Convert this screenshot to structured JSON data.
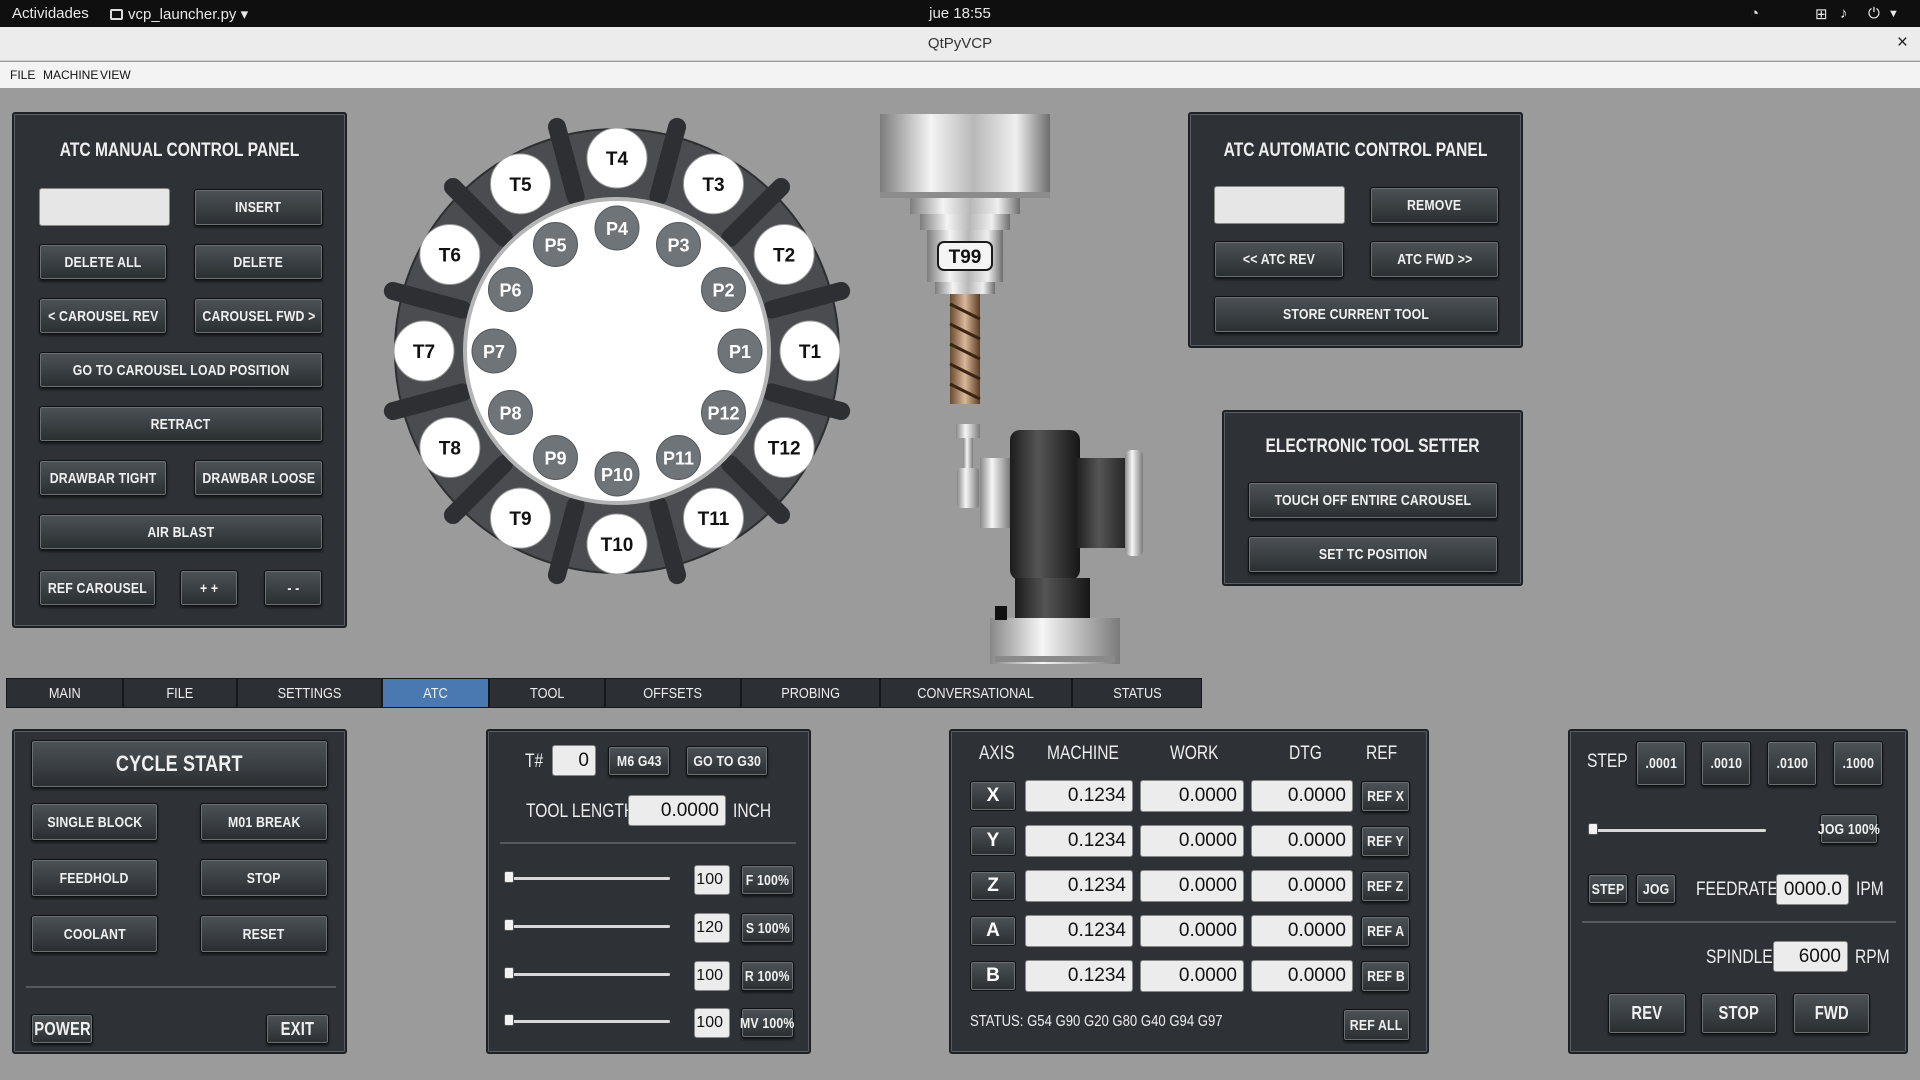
{
  "topbar": {
    "activities": "Actividades",
    "app_name": "vcp_launcher.py",
    "clock": "jue 18:55"
  },
  "window": {
    "title": "QtPyVCP",
    "close": "×"
  },
  "menu": [
    "FILE",
    "MACHINE",
    "VIEW"
  ],
  "atc_manual": {
    "title": "ATC MANUAL CONTROL PANEL",
    "tool_input": "",
    "insert": "INSERT",
    "delete_all": "DELETE ALL",
    "delete": "DELETE",
    "carousel_rev": "< CAROUSEL REV",
    "carousel_fwd": "CAROUSEL FWD >",
    "go_load": "GO TO CAROUSEL LOAD POSITION",
    "retract": "RETRACT",
    "drawbar_tight": "DRAWBAR TIGHT",
    "drawbar_loose": "DRAWBAR LOOSE",
    "air_blast": "AIR BLAST",
    "ref_carousel": "REF CAROUSEL",
    "plus": "+ +",
    "minus": "- -"
  },
  "carousel": {
    "tools": [
      "T1",
      "T2",
      "T3",
      "T4",
      "T5",
      "T6",
      "T7",
      "T8",
      "T9",
      "T10",
      "T11",
      "T12"
    ],
    "pockets": [
      "P1",
      "P2",
      "P3",
      "P4",
      "P5",
      "P6",
      "P7",
      "P8",
      "P9",
      "P10",
      "P11",
      "P12"
    ],
    "spindle_tool": "T99"
  },
  "atc_auto": {
    "title": "ATC AUTOMATIC CONTROL PANEL",
    "tool_input": "",
    "remove": "REMOVE",
    "atc_rev": "<< ATC REV",
    "atc_fwd": "ATC FWD >>",
    "store": "STORE CURRENT TOOL"
  },
  "tool_setter": {
    "title": "ELECTRONIC TOOL SETTER",
    "touch_off": "TOUCH OFF ENTIRE CAROUSEL",
    "set_tc": "SET TC POSITION"
  },
  "tabs": [
    {
      "label": "MAIN",
      "active": false
    },
    {
      "label": "FILE",
      "active": false
    },
    {
      "label": "SETTINGS",
      "active": false
    },
    {
      "label": "ATC",
      "active": true
    },
    {
      "label": "TOOL",
      "active": false
    },
    {
      "label": "OFFSETS",
      "active": false
    },
    {
      "label": "PROBING",
      "active": false
    },
    {
      "label": "CONVERSATIONAL",
      "active": false
    },
    {
      "label": "STATUS",
      "active": false
    }
  ],
  "cycle": {
    "cycle_start": "CYCLE START",
    "single_block": "SINGLE BLOCK",
    "m01_break": "M01 BREAK",
    "feedhold": "FEEDHOLD",
    "stop": "STOP",
    "coolant": "COOLANT",
    "reset": "RESET",
    "power": "POWER",
    "exit": "EXIT"
  },
  "tool_panel": {
    "t_label": "T#",
    "t_value": "0",
    "m6g43": "M6 G43",
    "gotog30": "GO TO G30",
    "tool_length_label": "TOOL LENGTH",
    "tool_length_value": "0.0000",
    "unit": "INCH",
    "overrides": [
      {
        "value": "100",
        "label": "F 100%",
        "level": 0
      },
      {
        "value": "120",
        "label": "S 100%",
        "level": 0
      },
      {
        "value": "100",
        "label": "R 100%",
        "level": 0
      },
      {
        "value": "100",
        "label": "MV 100%",
        "level": 0
      }
    ]
  },
  "dro": {
    "headers": [
      "AXIS",
      "MACHINE",
      "WORK",
      "DTG",
      "REF"
    ],
    "rows": [
      {
        "axis": "X",
        "machine": "0.1234",
        "work": "0.0000",
        "dtg": "0.0000",
        "ref": "REF X"
      },
      {
        "axis": "Y",
        "machine": "0.1234",
        "work": "0.0000",
        "dtg": "0.0000",
        "ref": "REF Y"
      },
      {
        "axis": "Z",
        "machine": "0.1234",
        "work": "0.0000",
        "dtg": "0.0000",
        "ref": "REF Z"
      },
      {
        "axis": "A",
        "machine": "0.1234",
        "work": "0.0000",
        "dtg": "0.0000",
        "ref": "REF A"
      },
      {
        "axis": "B",
        "machine": "0.1234",
        "work": "0.0000",
        "dtg": "0.0000",
        "ref": "REF B"
      }
    ],
    "status": "STATUS:  G54  G90  G20  G80  G40  G94  G97",
    "ref_all": "REF ALL"
  },
  "jog": {
    "step_label": "STEP",
    "steps": [
      ".0001",
      ".0010",
      ".0100",
      ".1000"
    ],
    "jog_pct": "JOG 100%",
    "jog_level": 0,
    "step_btn": "STEP",
    "jog_btn": "JOG",
    "feedrate_label": "FEEDRATE",
    "feedrate_value": "0000.0",
    "feedrate_unit": "IPM",
    "spindle_label": "SPINDLE",
    "spindle_value": "6000",
    "spindle_unit": "RPM",
    "rev": "REV",
    "stop": "STOP",
    "fwd": "FWD"
  },
  "colors": {
    "panel": "#2e3236",
    "active_tab": "#4a78b0",
    "background": "#9b9b9b"
  }
}
